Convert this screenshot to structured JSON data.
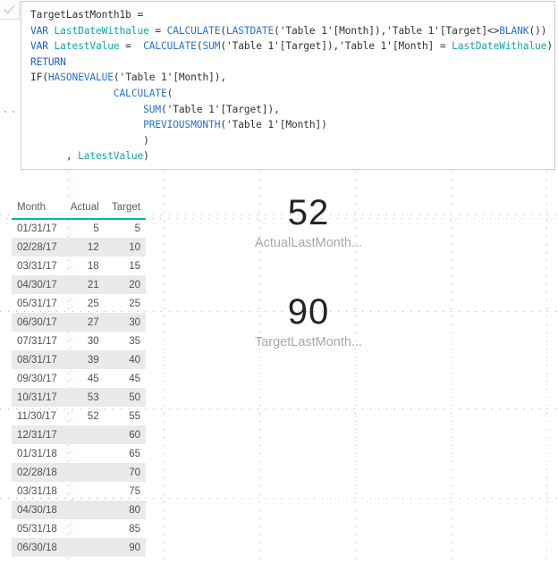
{
  "formula_bar": {
    "commit_icon": "checkmark-icon",
    "measure_name": "TargetLastMonth1b",
    "code_lines": [
      [
        {
          "t": "txt",
          "s": "TargetLastMonth1b ="
        }
      ],
      [
        {
          "t": "kw",
          "s": "VAR "
        },
        {
          "t": "var",
          "s": "LastDateWithalue"
        },
        {
          "t": "txt",
          "s": " = "
        },
        {
          "t": "fn",
          "s": "CALCULATE"
        },
        {
          "t": "txt",
          "s": "("
        },
        {
          "t": "fn",
          "s": "LASTDATE"
        },
        {
          "t": "txt",
          "s": "('Table 1'[Month]),'Table 1'[Target]<>"
        },
        {
          "t": "fn",
          "s": "BLANK"
        },
        {
          "t": "txt",
          "s": "())"
        }
      ],
      [
        {
          "t": "kw",
          "s": "VAR "
        },
        {
          "t": "var",
          "s": "LatestValue"
        },
        {
          "t": "txt",
          "s": " =  "
        },
        {
          "t": "fn",
          "s": "CALCULATE"
        },
        {
          "t": "txt",
          "s": "("
        },
        {
          "t": "fn",
          "s": "SUM"
        },
        {
          "t": "txt",
          "s": "('Table 1'[Target]),'Table 1'[Month] = "
        },
        {
          "t": "var",
          "s": "LastDateWithalue"
        },
        {
          "t": "txt",
          "s": ")"
        }
      ],
      [
        {
          "t": "kw",
          "s": "RETURN"
        }
      ],
      [
        {
          "t": "txt",
          "s": "IF("
        },
        {
          "t": "fn",
          "s": "HASONEVALUE"
        },
        {
          "t": "txt",
          "s": "('Table 1'[Month]),"
        }
      ],
      [
        {
          "t": "txt",
          "s": "              "
        },
        {
          "t": "fn",
          "s": "CALCULATE"
        },
        {
          "t": "txt",
          "s": "("
        }
      ],
      [
        {
          "t": "txt",
          "s": "                   "
        },
        {
          "t": "fn",
          "s": "SUM"
        },
        {
          "t": "txt",
          "s": "('Table 1'[Target]),"
        }
      ],
      [
        {
          "t": "txt",
          "s": "                   "
        },
        {
          "t": "fn",
          "s": "PREVIOUSMONTH"
        },
        {
          "t": "txt",
          "s": "('Table 1'[Month])"
        }
      ],
      [
        {
          "t": "txt",
          "s": "                   )"
        }
      ],
      [
        {
          "t": "txt",
          "s": "      , "
        },
        {
          "t": "var",
          "s": "LatestValue"
        },
        {
          "t": "txt",
          "s": ")"
        }
      ]
    ]
  },
  "table_visual": {
    "columns": [
      "Month",
      "Actual",
      "Target"
    ],
    "header_underline_color": "#01b8aa",
    "rows": [
      {
        "month": "01/31/17",
        "actual": "5",
        "target": "5"
      },
      {
        "month": "02/28/17",
        "actual": "12",
        "target": "10"
      },
      {
        "month": "03/31/17",
        "actual": "18",
        "target": "15"
      },
      {
        "month": "04/30/17",
        "actual": "21",
        "target": "20"
      },
      {
        "month": "05/31/17",
        "actual": "25",
        "target": "25"
      },
      {
        "month": "06/30/17",
        "actual": "27",
        "target": "30"
      },
      {
        "month": "07/31/17",
        "actual": "30",
        "target": "35"
      },
      {
        "month": "08/31/17",
        "actual": "39",
        "target": "40"
      },
      {
        "month": "09/30/17",
        "actual": "45",
        "target": "45"
      },
      {
        "month": "10/31/17",
        "actual": "53",
        "target": "50"
      },
      {
        "month": "11/30/17",
        "actual": "52",
        "target": "55"
      },
      {
        "month": "12/31/17",
        "actual": "",
        "target": "60"
      },
      {
        "month": "01/31/18",
        "actual": "",
        "target": "65"
      },
      {
        "month": "02/28/18",
        "actual": "",
        "target": "70"
      },
      {
        "month": "03/31/18",
        "actual": "",
        "target": "75"
      },
      {
        "month": "04/30/18",
        "actual": "",
        "target": "80"
      },
      {
        "month": "05/31/18",
        "actual": "",
        "target": "85"
      },
      {
        "month": "06/30/18",
        "actual": "",
        "target": "90"
      }
    ]
  },
  "cards": [
    {
      "value": "52",
      "label": "ActualLastMonth..."
    },
    {
      "value": "90",
      "label": "TargetLastMonth..."
    }
  ],
  "canvas": {
    "grid_visible": true,
    "grid_dot_color": "#b0b0b0",
    "vertical_guides": [
      76,
      183,
      290,
      397,
      504,
      611
    ],
    "horizontal_guides": [
      240,
      348,
      457,
      557
    ]
  }
}
